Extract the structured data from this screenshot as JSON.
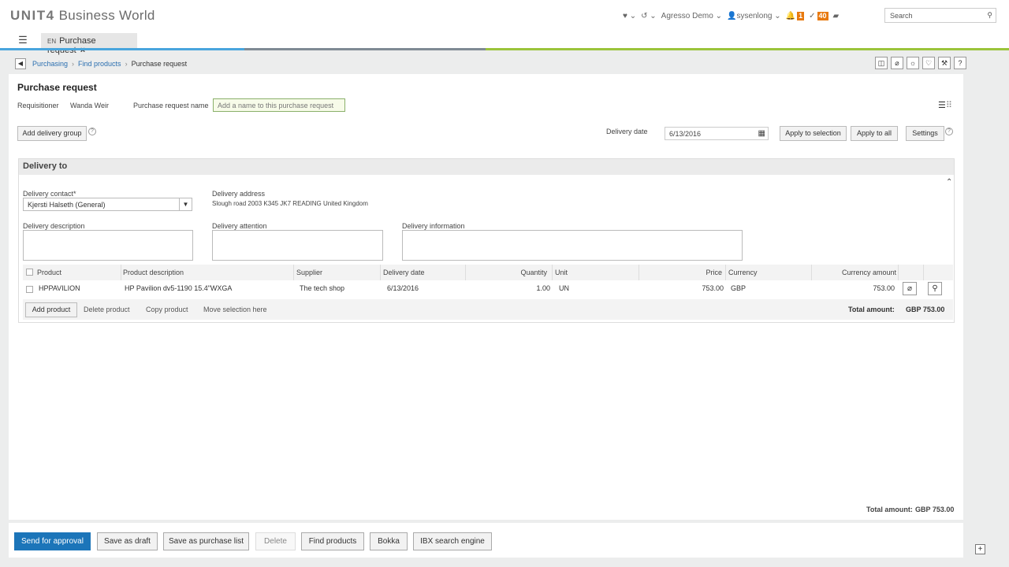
{
  "app": {
    "logo_brand": "UNIT4",
    "logo_product": "Business World"
  },
  "topbar": {
    "company": "Agresso Demo",
    "user": "sysenlong",
    "notifications_count": "1",
    "tasks_count": "40",
    "search_placeholder": "Search"
  },
  "tabs": [
    {
      "lang": "EN",
      "label": "Purchase request",
      "close": "×"
    }
  ],
  "breadcrumb": {
    "items": [
      "Purchasing",
      "Find products",
      "Purchase request"
    ]
  },
  "page": {
    "title": "Purchase request",
    "requisitioner_label": "Requisitioner",
    "requisitioner_value": "Wanda Weir",
    "name_label": "Purchase request name",
    "name_placeholder": "Add a name to this purchase request",
    "add_delivery_group": "Add delivery group",
    "delivery_date_label": "Delivery date",
    "delivery_date_value": "6/13/2016",
    "apply_to_selection": "Apply to selection",
    "apply_to_all": "Apply to all",
    "settings": "Settings"
  },
  "delivery": {
    "section_title": "Delivery to",
    "contact_label": "Delivery contact*",
    "contact_value": "Kjersti Halseth (General)",
    "address_label": "Delivery address",
    "address_value": "Slough road 2003 K345 JK7 READING United Kingdom",
    "description_label": "Delivery description",
    "attention_label": "Delivery attention",
    "information_label": "Delivery information"
  },
  "grid": {
    "columns": [
      "Product",
      "Product description",
      "Supplier",
      "Delivery date",
      "Quantity",
      "Unit",
      "Price",
      "Currency",
      "Currency amount"
    ],
    "rows": [
      {
        "product": "HPPAVILION",
        "description": "HP Pavilion dv5-1190 15.4\"WXGA",
        "supplier": "The tech shop",
        "delivery_date": "6/13/2016",
        "quantity": "1.00",
        "unit": "UN",
        "price": "753.00",
        "currency": "GBP",
        "currency_amount": "753.00"
      }
    ],
    "add_product": "Add product",
    "delete_product": "Delete product",
    "copy_product": "Copy product",
    "move_selection": "Move selection here",
    "total_label": "Total amount:",
    "total_value": "GBP 753.00"
  },
  "summary": {
    "total_label": "Total amount:",
    "total_value": "GBP 753.00"
  },
  "actions": {
    "send_for_approval": "Send for approval",
    "save_as_draft": "Save as draft",
    "save_as_purchase_list": "Save as purchase list",
    "delete": "Delete",
    "find_products": "Find products",
    "bokka": "Bokka",
    "ibx_search": "IBX search engine"
  },
  "colors": {
    "accent_blue": "#1c75b9",
    "link_blue": "#2b6fb0",
    "badge_orange": "#e8790e"
  }
}
